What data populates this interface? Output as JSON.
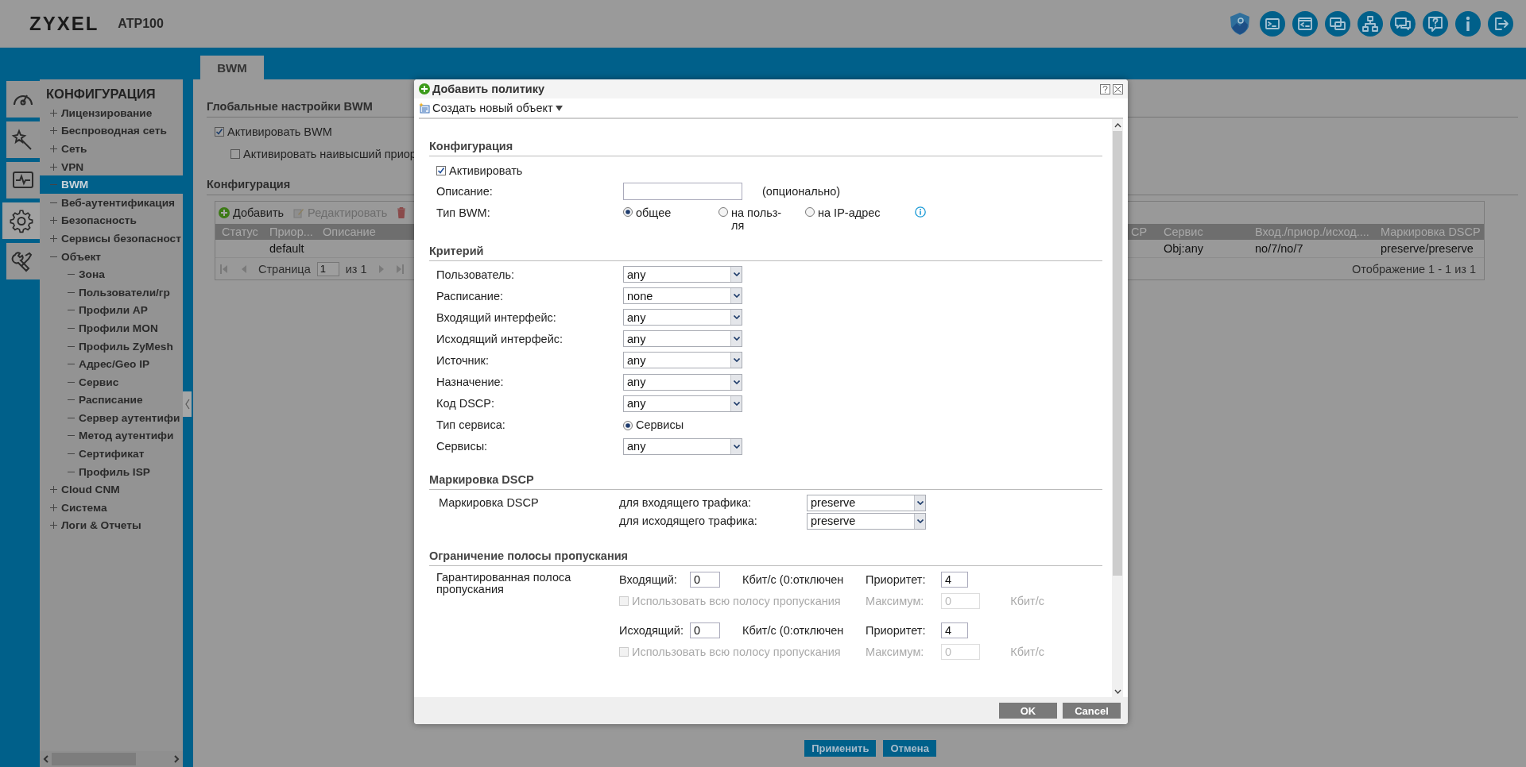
{
  "header": {
    "logo": "ZYXEL",
    "model": "ATP100"
  },
  "rail": [
    {
      "selected": false
    },
    {
      "selected": false
    },
    {
      "selected": false
    },
    {
      "selected": true
    },
    {
      "selected": false
    }
  ],
  "menu": {
    "title": "КОНФИГУРАЦИЯ",
    "items": [
      {
        "label": "Лицензирование",
        "kind": "folder",
        "expanded": false,
        "selected": false
      },
      {
        "label": "Беспроводная сеть",
        "kind": "folder",
        "expanded": false,
        "selected": false
      },
      {
        "label": "Сеть",
        "kind": "folder",
        "expanded": false,
        "selected": false
      },
      {
        "label": "VPN",
        "kind": "folder",
        "expanded": false,
        "selected": false
      },
      {
        "label": "BWM",
        "kind": "leaf",
        "selected": true
      },
      {
        "label": "Веб-аутентификация",
        "kind": "leaf",
        "selected": false
      },
      {
        "label": "Безопасность",
        "kind": "folder",
        "expanded": false,
        "selected": false
      },
      {
        "label": "Сервисы безопасност",
        "kind": "folder",
        "expanded": false,
        "selected": false
      },
      {
        "label": "Объект",
        "kind": "folder",
        "expanded": true,
        "selected": false,
        "children": [
          {
            "label": "Зона",
            "kind": "leaf",
            "selected": false
          },
          {
            "label": "Пользователи/гр",
            "kind": "leaf",
            "selected": false
          },
          {
            "label": "Профили AP",
            "kind": "leaf",
            "selected": false
          },
          {
            "label": "Профили MON",
            "kind": "leaf",
            "selected": false
          },
          {
            "label": "Профиль ZyMesh",
            "kind": "leaf",
            "selected": false
          },
          {
            "label": "Адрес/Geo IP",
            "kind": "leaf",
            "selected": false
          },
          {
            "label": "Сервис",
            "kind": "leaf",
            "selected": false
          },
          {
            "label": "Расписание",
            "kind": "leaf",
            "selected": false
          },
          {
            "label": "Сервер аутентифи",
            "kind": "leaf",
            "selected": false
          },
          {
            "label": "Метод аутентифи",
            "kind": "leaf",
            "selected": false
          },
          {
            "label": "Сертификат",
            "kind": "leaf",
            "selected": false
          },
          {
            "label": "Профиль ISP",
            "kind": "leaf",
            "selected": false
          }
        ]
      },
      {
        "label": "Cloud CNM",
        "kind": "folder",
        "expanded": false,
        "selected": false
      },
      {
        "label": "Система",
        "kind": "folder",
        "expanded": false,
        "selected": false
      },
      {
        "label": "Логи & Отчеты",
        "kind": "folder",
        "expanded": false,
        "selected": false
      }
    ]
  },
  "tabs": [
    {
      "label": "BWM",
      "selected": true
    }
  ],
  "global_settings": {
    "title": "Глобальные настройки BWM",
    "options": [
      {
        "label": "Активировать BWM",
        "checked": true
      },
      {
        "label": "Активировать наивысший приор",
        "checked": false
      }
    ]
  },
  "configuration": {
    "title": "Конфигурация",
    "toolbar": [
      {
        "kind": "add",
        "label": "Добавить",
        "disabled": false
      },
      {
        "kind": "edit",
        "label": "Редактировать",
        "disabled": true
      },
      {
        "kind": "delete",
        "disabled": true
      }
    ],
    "columns_left": [
      "Статус",
      "Приор...",
      "Описание"
    ],
    "columns_right": [
      "CP",
      "Сервис",
      "Вход./приор./исход....",
      "Маркировка DSCP"
    ],
    "rows": [
      {
        "priority": "default",
        "service": "Obj:any",
        "in_priority_out": "no/7/no/7",
        "dscp_marking": "preserve/preserve"
      }
    ],
    "pager": {
      "page_label": "Страница",
      "page": "1",
      "of": "из 1",
      "summary": "Отображение 1 - 1 из 1"
    }
  },
  "page_buttons": [
    "Применить",
    "Отмена"
  ],
  "dialog": {
    "title": "Добавить политику",
    "toolbar_item": "Создать новый объект",
    "config": {
      "title": "Конфигурация",
      "activate": {
        "label": "Активировать",
        "checked": true
      },
      "description": {
        "label": "Описание:",
        "hint": "(опционально)"
      },
      "bwm_type": {
        "label": "Тип BWM:",
        "options": [
          {
            "label": "общее",
            "selected": true
          },
          {
            "label": "на польз-ля",
            "selected": false
          },
          {
            "label": "на IP-адрес",
            "selected": false
          }
        ]
      }
    },
    "criteria": {
      "title": "Критерий",
      "rows": [
        {
          "label": "Пользователь:",
          "kind": "select",
          "value": "any"
        },
        {
          "label": "Расписание:",
          "kind": "select",
          "value": "none"
        },
        {
          "label": "Входящий интерфейс:",
          "kind": "select",
          "value": "any"
        },
        {
          "label": "Исходящий интерфейс:",
          "kind": "select",
          "value": "any"
        },
        {
          "label": "Источник:",
          "kind": "select",
          "value": "any"
        },
        {
          "label": "Назначение:",
          "kind": "select",
          "value": "any"
        },
        {
          "label": "Код DSCP:",
          "kind": "select",
          "value": "any"
        },
        {
          "label": "Тип сервиса:",
          "kind": "radio",
          "options": [
            {
              "label": "Сервисы",
              "selected": true
            }
          ]
        },
        {
          "label": "Сервисы:",
          "kind": "select",
          "value": "any"
        }
      ]
    },
    "dscp": {
      "title": "Маркировка DSCP",
      "label": "Маркировка DSCP",
      "rows": [
        {
          "label": "для входящего трафика:",
          "value": "preserve"
        },
        {
          "label": "для исходящего трафика:",
          "value": "preserve"
        }
      ]
    },
    "bandwidth": {
      "title": "Ограничение полосы пропускания",
      "label": "Гарантированная полоса пропускания",
      "directions": [
        {
          "label": "Входящий:",
          "value": "0",
          "unit": "Кбит/с (0:отключен",
          "priority_label": "Приоритет:",
          "priority": "4",
          "use_all": {
            "label": "Использовать всю полосу пропускания",
            "checked": false,
            "disabled": true
          },
          "max_label": "Максимум:",
          "max": "0",
          "max_unit": "Кбит/с"
        },
        {
          "label": "Исходящий:",
          "value": "0",
          "unit": "Кбит/с (0:отключен",
          "priority_label": "Приоритет:",
          "priority": "4",
          "use_all": {
            "label": "Использовать всю полосу пропускания",
            "checked": false,
            "disabled": true
          },
          "max_label": "Максимум:",
          "max": "0",
          "max_unit": "Кбит/с"
        }
      ]
    },
    "buttons": [
      "OK",
      "Cancel"
    ]
  }
}
